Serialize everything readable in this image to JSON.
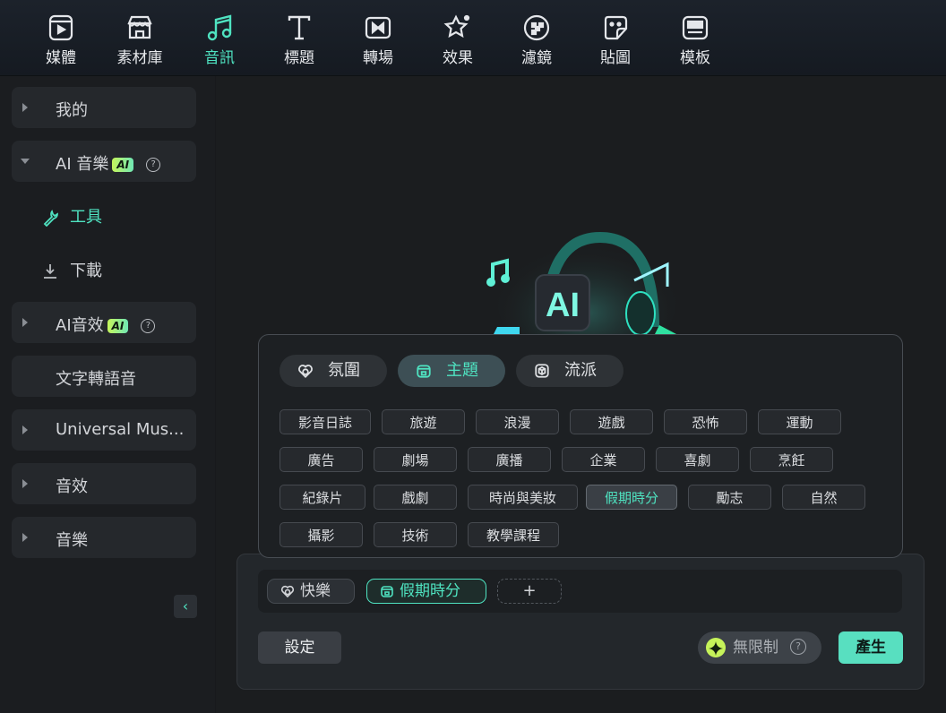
{
  "toolbar": {
    "items": [
      {
        "label": "媒體",
        "icon": "media-icon"
      },
      {
        "label": "素材庫",
        "icon": "stock-library-icon"
      },
      {
        "label": "音訊",
        "icon": "music-note-icon",
        "active": true
      },
      {
        "label": "標題",
        "icon": "title-text-icon"
      },
      {
        "label": "轉場",
        "icon": "transition-icon"
      },
      {
        "label": "效果",
        "icon": "effects-star-icon"
      },
      {
        "label": "濾鏡",
        "icon": "filter-icon"
      },
      {
        "label": "貼圖",
        "icon": "sticker-icon"
      },
      {
        "label": "模板",
        "icon": "template-icon"
      }
    ],
    "accent_color": "#4fe3c1"
  },
  "sidebar": {
    "my": "我的",
    "ai_music": "AI 音樂",
    "ai_badge": "AI",
    "help": "?",
    "tools": "工具",
    "download": "下載",
    "ai_sfx": "AI音效",
    "tts": "文字轉語音",
    "universal": "Universal Mus...",
    "sound_effects": "音效",
    "music": "音樂",
    "collapse": "‹"
  },
  "popover": {
    "tabs": [
      {
        "label": "氛圍",
        "icon": "mood-heart-icon"
      },
      {
        "label": "主題",
        "icon": "theme-icon",
        "active": true
      },
      {
        "label": "流派",
        "icon": "genre-cube-icon"
      }
    ],
    "tags": [
      "影音日誌",
      "旅遊",
      "浪漫",
      "遊戲",
      "恐怖",
      "運動",
      "廣告",
      "劇場",
      "廣播",
      "企業",
      "喜劇",
      "烹飪",
      "紀錄片",
      "戲劇",
      "時尚與美妝",
      "假期時分",
      "勵志",
      "自然",
      "攝影",
      "技術",
      "教學課程"
    ],
    "selected_tag": "假期時分"
  },
  "prompt": {
    "chips": [
      {
        "label": "快樂",
        "icon": "mood-heart-icon"
      },
      {
        "label": "假期時分",
        "icon": "theme-icon"
      }
    ],
    "add": "+",
    "settings": "設定",
    "credits": "無限制",
    "credits_help": "?",
    "generate": "產生"
  },
  "hero": {
    "text": "AI"
  }
}
